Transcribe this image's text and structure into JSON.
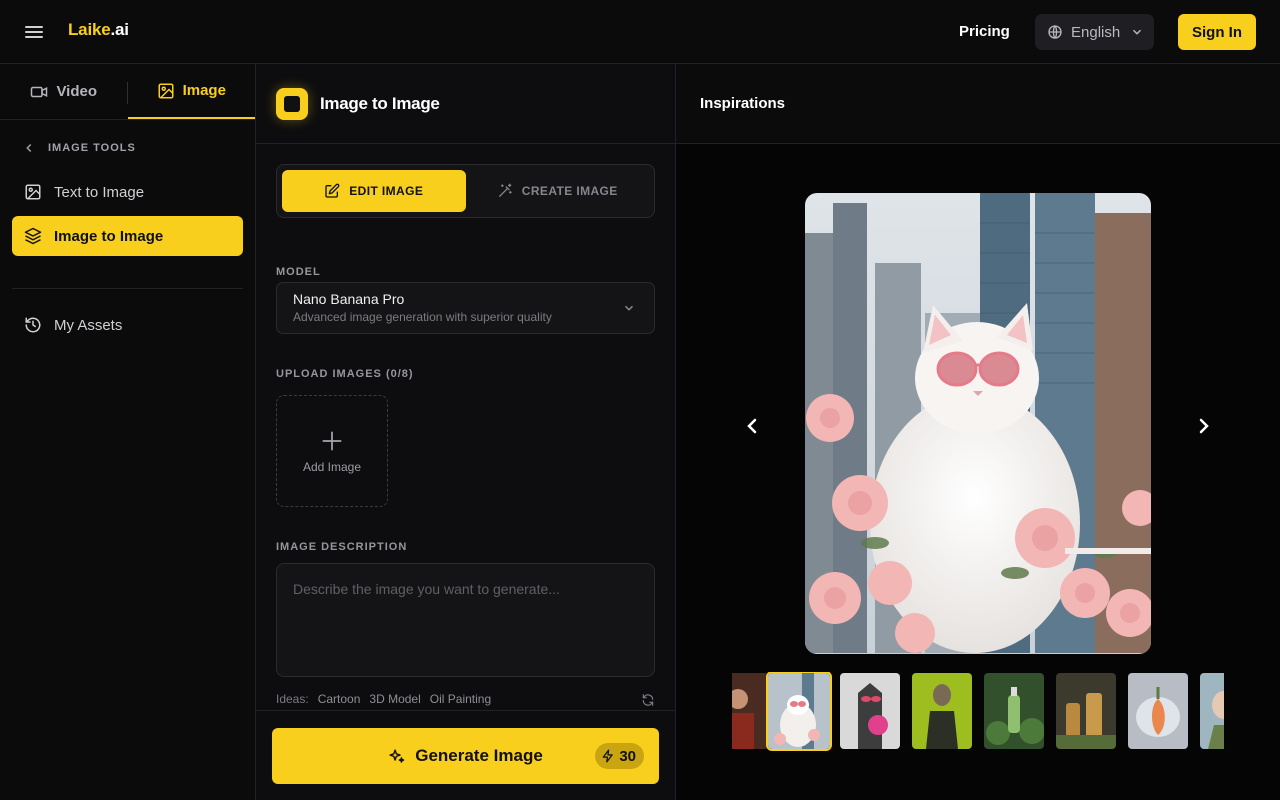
{
  "header": {
    "logo_brand": "Laike",
    "logo_tld": ".ai",
    "pricing": "Pricing",
    "language": "English",
    "sign_in": "Sign In"
  },
  "sidebar": {
    "tabs": [
      {
        "label": "Video",
        "icon": "video-icon"
      },
      {
        "label": "Image",
        "icon": "image-icon",
        "active": true
      }
    ],
    "section_title": "IMAGE TOOLS",
    "items": [
      {
        "label": "Text to Image",
        "icon": "image-icon"
      },
      {
        "label": "Image to Image",
        "icon": "layers-icon",
        "active": true
      },
      {
        "label": "My Assets",
        "icon": "history-icon"
      }
    ]
  },
  "panel": {
    "title": "Image to Image",
    "modes": [
      {
        "label": "EDIT IMAGE",
        "icon": "edit-icon",
        "active": true
      },
      {
        "label": "CREATE IMAGE",
        "icon": "magic-wand-icon"
      }
    ],
    "model_label": "MODEL",
    "model_name": "Nano Banana Pro",
    "model_desc": "Advanced image generation with superior quality",
    "upload_label": "UPLOAD IMAGES (0/8)",
    "add_image": "Add Image",
    "description_label": "IMAGE DESCRIPTION",
    "description_placeholder": "Describe the image you want to generate...",
    "ideas_label": "Ideas:",
    "ideas": [
      "Cartoon",
      "3D Model",
      "Oil Painting"
    ],
    "generate": "Generate Image",
    "credits": "30"
  },
  "inspirations": {
    "title": "Inspirations",
    "active_index": 1
  },
  "colors": {
    "accent": "#f8cf1c",
    "background": "#0b0b0c",
    "panel": "#141417"
  }
}
